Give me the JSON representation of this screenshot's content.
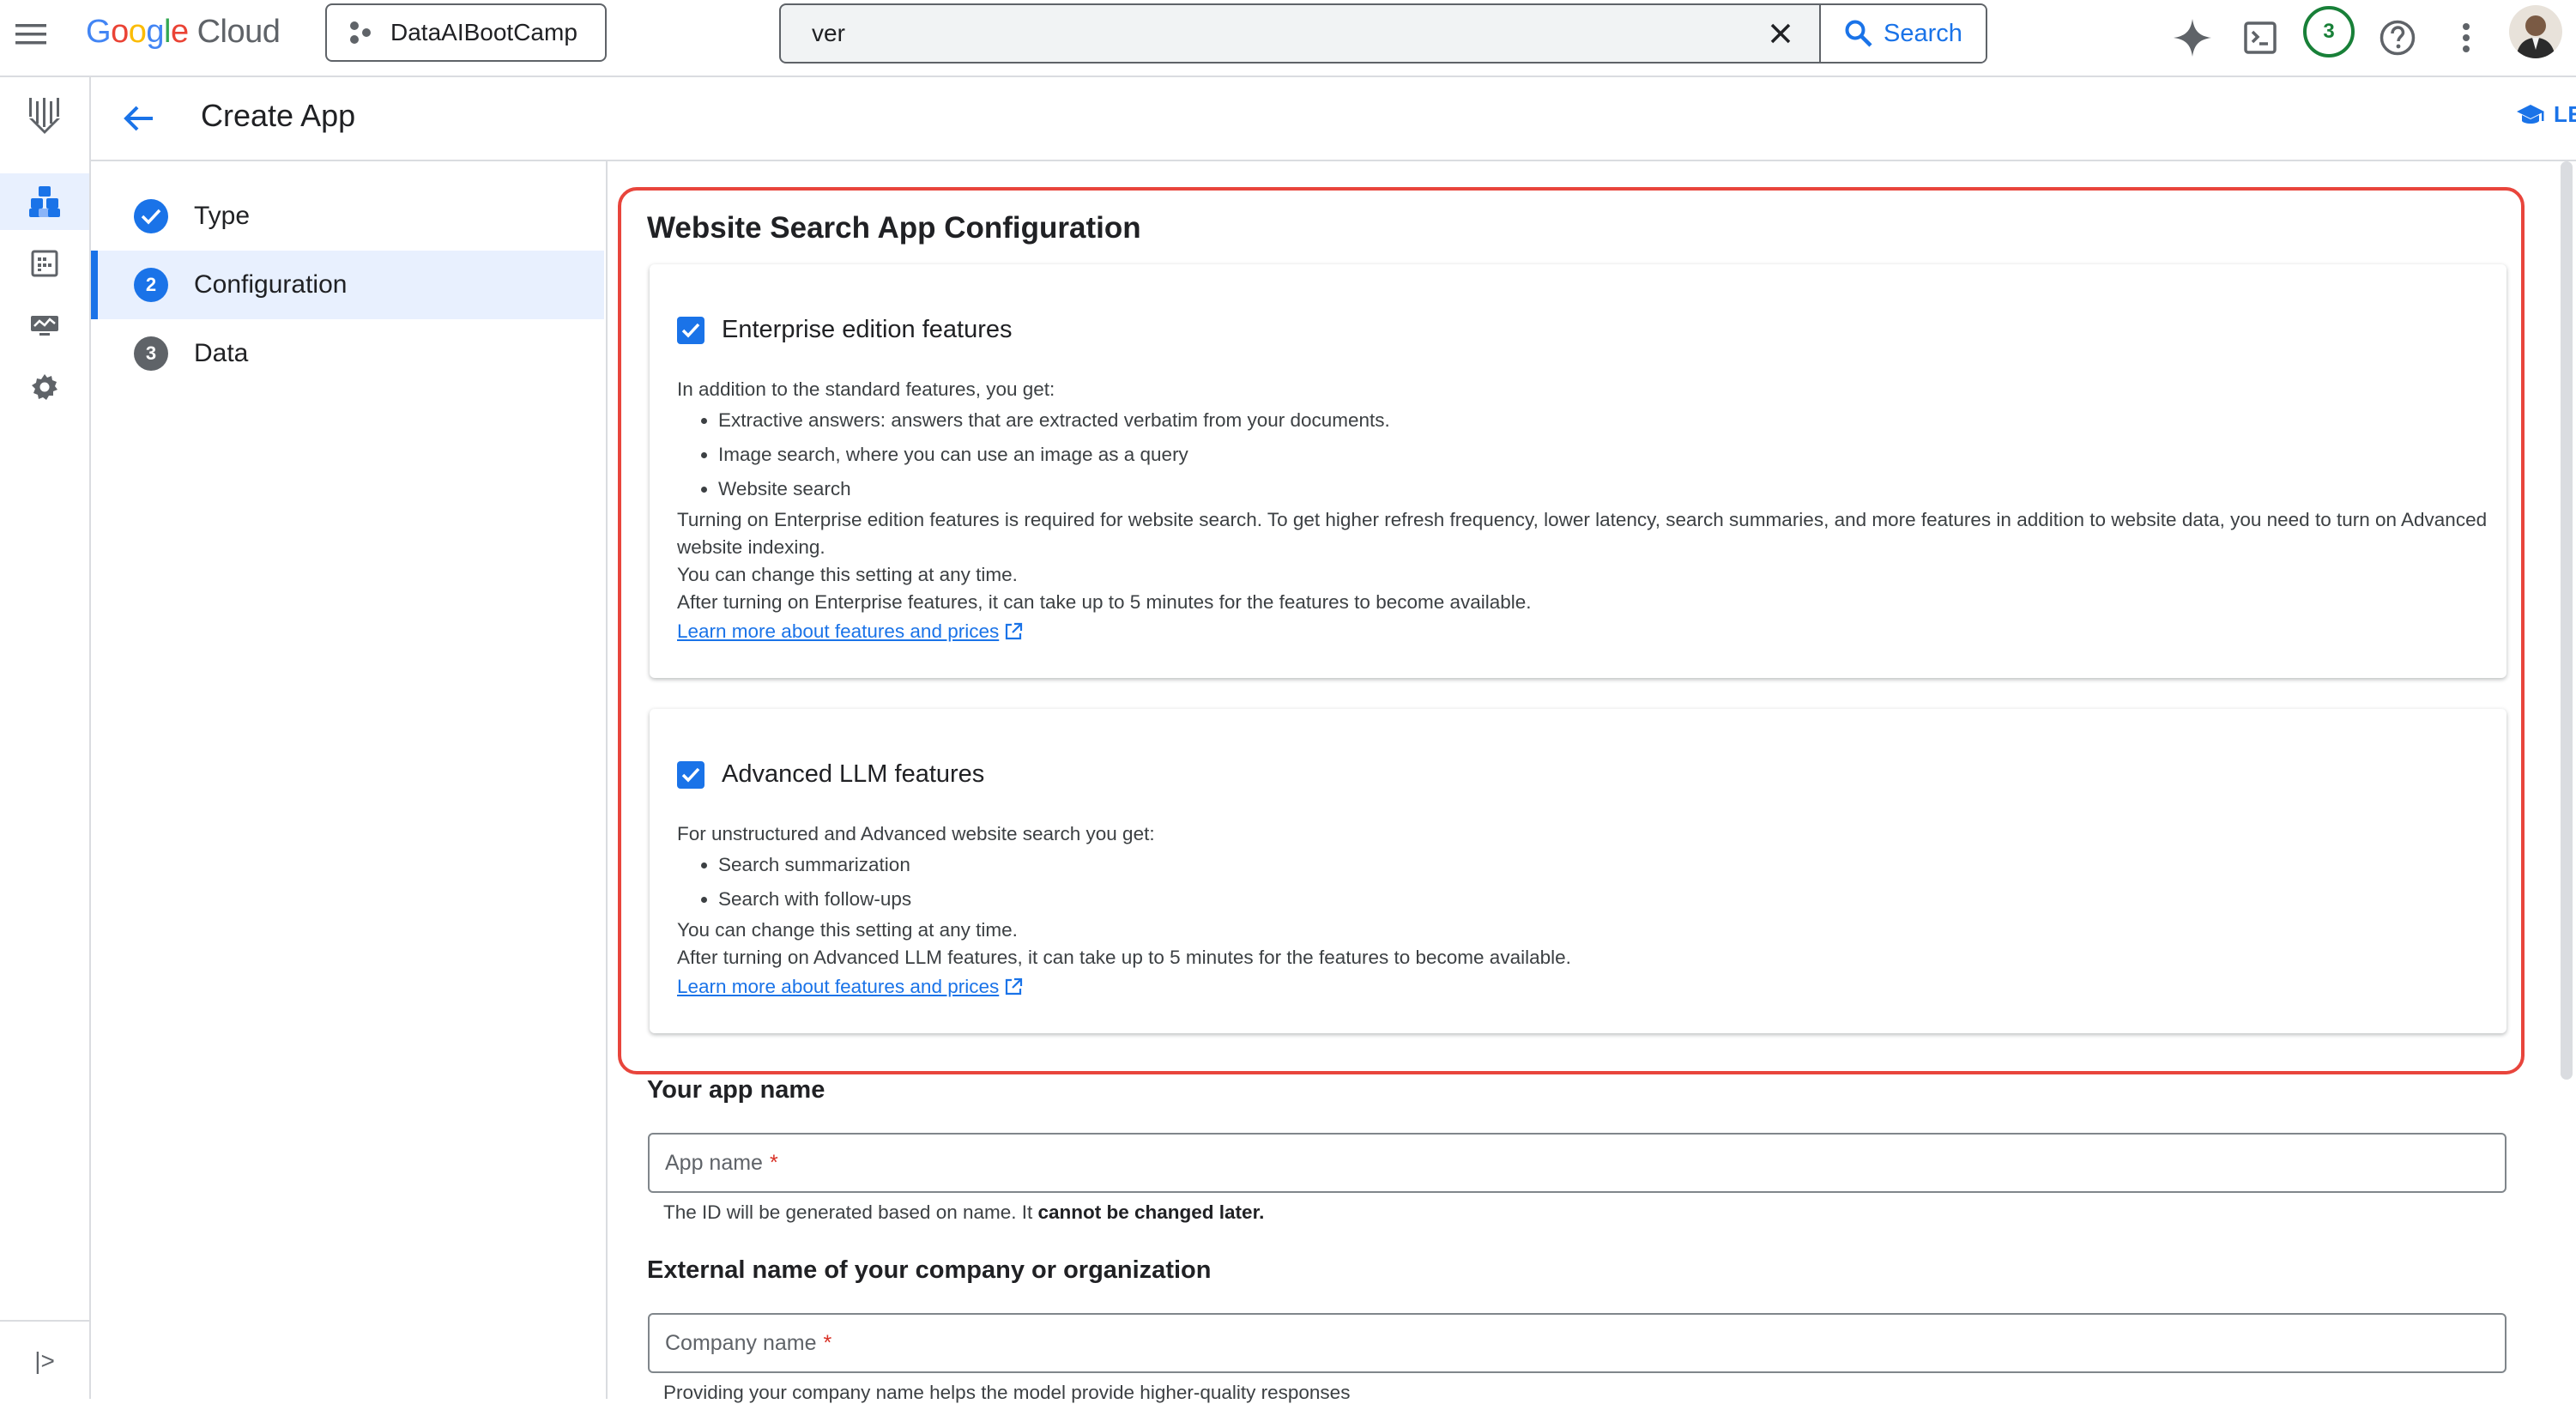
{
  "topbar": {
    "menu_icon": "hamburger-menu-icon",
    "logo": {
      "google": "Google",
      "cloud": "Cloud"
    },
    "project": "DataAIBootCamp",
    "search": {
      "value": "ver",
      "button_label": "Search"
    },
    "notifications_count": "3",
    "icons": [
      "gemini-sparkle-icon",
      "cloud-shell-icon",
      "help-icon",
      "more-vert-icon"
    ]
  },
  "rail": {
    "items": [
      "agent-builder-logo-icon",
      "apps-icon",
      "data-stores-icon",
      "monitoring-icon",
      "settings-icon"
    ],
    "expand_label": "|>"
  },
  "header": {
    "title": "Create App",
    "learn_label": "LEARN"
  },
  "stepper": {
    "steps": [
      {
        "number": "1",
        "label": "Type",
        "state": "done"
      },
      {
        "number": "2",
        "label": "Configuration",
        "state": "active"
      },
      {
        "number": "3",
        "label": "Data",
        "state": "pending"
      }
    ]
  },
  "config": {
    "title": "Website Search App Configuration",
    "enterprise": {
      "label": "Enterprise edition features",
      "checked": true,
      "intro": "In addition to the standard features, you get:",
      "bullets": [
        "Extractive answers: answers that are extracted verbatim from your documents.",
        "Image search, where you can use an image as a query",
        "Website search"
      ],
      "para1": "Turning on Enterprise edition features is required for website search. To get higher refresh frequency, lower latency, search summaries, and more features in addition to website data, you need to turn on Advanced website indexing.",
      "para2": "You can change this setting at any time.",
      "para3": "After turning on Enterprise features, it can take up to 5 minutes for the features to become available.",
      "link": "Learn more about features and prices"
    },
    "llm": {
      "label": "Advanced LLM features",
      "checked": true,
      "intro": "For unstructured and Advanced website search you get:",
      "bullets": [
        "Search summarization",
        "Search with follow-ups"
      ],
      "para1": "You can change this setting at any time.",
      "para2": "After turning on Advanced LLM features, it can take up to 5 minutes for the features to become available.",
      "link": "Learn more about features and prices"
    }
  },
  "app_name": {
    "section_label": "Your app name",
    "placeholder": "App name",
    "required_mark": "*",
    "hint_prefix": "The ID will be generated based on name. It ",
    "hint_bold": "cannot be changed later."
  },
  "company": {
    "section_label": "External name of your company or organization",
    "placeholder": "Company name",
    "required_mark": "*",
    "hint": "Providing your company name helps the model provide higher-quality responses"
  },
  "colors": {
    "accent": "#1a73e8",
    "highlight_border": "#e8453c",
    "badge": "#188038"
  }
}
